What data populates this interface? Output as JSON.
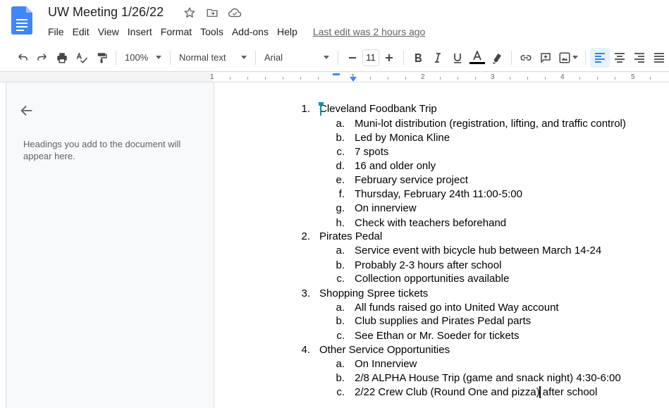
{
  "header": {
    "title": "UW Meeting 1/26/22",
    "last_edit": "Last edit was 2 hours ago"
  },
  "menu": [
    "File",
    "Edit",
    "View",
    "Insert",
    "Format",
    "Tools",
    "Add-ons",
    "Help"
  ],
  "toolbar": {
    "zoom": "100%",
    "style": "Normal text",
    "font": "Arial",
    "font_size": "11",
    "text_color": "#000000",
    "active_align": "align-left"
  },
  "ruler": {
    "marks": [
      "1",
      "1",
      "2",
      "3",
      "4",
      "5"
    ]
  },
  "outline": {
    "empty_text": "Headings you add to the document will appear here."
  },
  "document": {
    "items": [
      {
        "num": "1.",
        "text": "Cleveland Foodbank Trip",
        "sub": [
          {
            "num": "a.",
            "text": "Muni-lot distribution (registration, lifting, and traffic control)"
          },
          {
            "num": "b.",
            "text": "Led by Monica Kline"
          },
          {
            "num": "c.",
            "text": "7 spots"
          },
          {
            "num": "d.",
            "text": "16 and older only"
          },
          {
            "num": "e.",
            "text": "February service project"
          },
          {
            "num": "f.",
            "text": "Thursday, February 24th 11:00-5:00"
          },
          {
            "num": "g.",
            "text": "On innerview"
          },
          {
            "num": "h.",
            "text": "Check with teachers beforehand"
          }
        ]
      },
      {
        "num": "2.",
        "text": "Pirates Pedal",
        "sub": [
          {
            "num": "a.",
            "text": "Service event with bicycle hub between March 14-24"
          },
          {
            "num": "b.",
            "text": "Probably 2-3 hours after school"
          },
          {
            "num": "c.",
            "text": "Collection opportunities available"
          }
        ]
      },
      {
        "num": "3.",
        "text": "Shopping Spree tickets",
        "sub": [
          {
            "num": "a.",
            "text": "All funds raised go into United Way account"
          },
          {
            "num": "b.",
            "text": "Club supplies and Pirates Pedal parts"
          },
          {
            "num": "c.",
            "text": "See Ethan or Mr. Soeder for tickets"
          }
        ]
      },
      {
        "num": "4.",
        "text": "Other Service Opportunities",
        "sub": [
          {
            "num": "a.",
            "text": "On Innerview"
          },
          {
            "num": "b.",
            "text": "2/8 ALPHA House Trip (game and snack night) 4:30-6:00"
          },
          {
            "num": "c.",
            "text": "2/22 Crew Club (Round One and pizza) after school"
          }
        ]
      }
    ]
  }
}
